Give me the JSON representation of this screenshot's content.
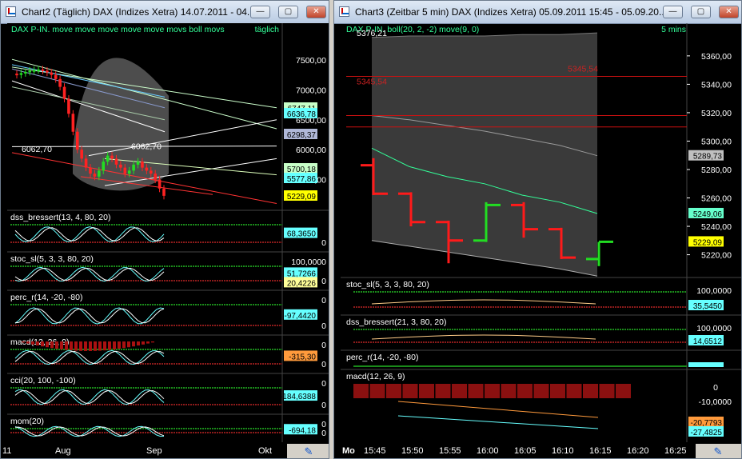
{
  "win1": {
    "title": "Chart2 (Täglich)  DAX (Indizes Xetra) 14.07.2011 - 04....",
    "buttons": [
      "—",
      "▢",
      "✕"
    ],
    "header": {
      "left": "DAX P-IN. move move move move move movs boll movs",
      "right": "täglich"
    },
    "main_ticks": [
      "7500,00",
      "7000,00",
      "6500,00",
      "6000,00",
      "5500,00"
    ],
    "annotations": [
      "6062,70",
      "6062,70"
    ],
    "value_boxes": [
      {
        "label": "6747,11",
        "color": "#c8ffc8"
      },
      {
        "label": "6636,78",
        "color": "#66ffff"
      },
      {
        "label": "6298,37",
        "color": "#b0b8d8"
      },
      {
        "label": "5700,18",
        "color": "#c8ffc8"
      },
      {
        "label": "5577,86",
        "color": "#66ffff"
      },
      {
        "label": "5229,09",
        "color": "#ffff00"
      }
    ],
    "panels": [
      {
        "name": "dss_bressert(13, 4, 80, 20)",
        "box": "68,3650",
        "box_color": "#66ffff",
        "zero": "0",
        "top": ""
      },
      {
        "name": "stoc_sl(5, 3, 3, 80, 20)",
        "box": "51,7266",
        "box2": "20,4226",
        "box_color": "#66ffff",
        "box2_color": "#ffff99",
        "zero": "0",
        "top": "100,0000"
      },
      {
        "name": "perc_r(14, -20, -80)",
        "box": "-97,4420",
        "box_color": "#66ffff",
        "zero": "0",
        "top": "0"
      },
      {
        "name": "macd(12, 26, 9)",
        "box": "-315,30",
        "box_color": "#ff9a3c",
        "zero": "0",
        "top": "0"
      },
      {
        "name": "cci(20, 100, -100)",
        "box": "-184,6388",
        "box_color": "#66ffff",
        "zero": "0",
        "top": "0"
      },
      {
        "name": "mom(20)",
        "box": "-694,18",
        "box_color": "#66ffff",
        "zero": "0",
        "top": "0"
      }
    ],
    "xaxis": [
      "11",
      "Aug",
      "Sep",
      "Okt"
    ]
  },
  "win2": {
    "title": "Chart3 (Zeitbar 5 min)  DAX (Indizes Xetra) 05.09.2011 15:45 - 05.09.20...",
    "buttons": [
      "—",
      "▢",
      "✕"
    ],
    "header": {
      "left": "DAX P-IN. boll(20, 2, -2) move(9, 0)",
      "right": "5 mins"
    },
    "main_ticks": [
      "5360,00",
      "5340,00",
      "5320,00",
      "5300,00",
      "5280,00",
      "5260,00",
      "5240,00",
      "5220,00"
    ],
    "annotations": [
      "5376,21",
      "5345,54",
      "5345,54"
    ],
    "value_boxes": [
      {
        "label": "5289,73",
        "color": "#c0c0c0"
      },
      {
        "label": "5249,06",
        "color": "#66ffcc"
      },
      {
        "label": "5229,09",
        "color": "#ffff00"
      }
    ],
    "panels": [
      {
        "name": "stoc_sl(5, 3, 3, 80, 20)",
        "top": "100,0000",
        "box": "35,5450",
        "box_color": "#66ffff"
      },
      {
        "name": "dss_bressert(21, 3, 80, 20)",
        "top": "100,0000",
        "box": "14,6512",
        "box_color": "#66ffff"
      },
      {
        "name": "perc_r(14, -20, -80)"
      },
      {
        "name": "macd(12, 26, 9)",
        "top": "0",
        "mid": "-10,0000",
        "box": "-20,7793",
        "box2": "-27,4825",
        "box_color": "#ff9a3c",
        "box2_color": "#66ffff"
      }
    ],
    "xaxis": [
      "Mo",
      "15:45",
      "15:50",
      "15:55",
      "16:00",
      "16:05",
      "16:10",
      "16:15",
      "16:20",
      "16:25"
    ]
  },
  "chart_data": [
    {
      "type": "bar",
      "title": "DAX P-IN. move move move move move movs boll movs",
      "timeframe": "täglich",
      "y_ticks": [
        5500,
        6000,
        6500,
        7000,
        7500
      ],
      "ylim": [
        5000,
        7900
      ],
      "last_values": [
        6747.11,
        6636.78,
        6298.37,
        5700.18,
        5577.86,
        5229.09
      ],
      "close_series": [
        7250,
        7280,
        7300,
        7320,
        7330,
        7340,
        7320,
        7290,
        7250,
        7180,
        7050,
        6850,
        6600,
        6300,
        6000,
        5850,
        5700,
        5600,
        5550,
        5650,
        5800,
        5900,
        5850,
        5750,
        5700,
        5600,
        5650,
        5750,
        5800,
        5700,
        5650,
        5600,
        5500,
        5350,
        5229.09
      ],
      "xaxis": [
        "11",
        "Aug",
        "Sep",
        "Okt"
      ]
    },
    {
      "type": "bar",
      "title": "DAX P-IN. boll(20, 2, -2) move(9, 0)",
      "timeframe": "5 mins",
      "y_ticks": [
        5220,
        5240,
        5260,
        5280,
        5300,
        5320,
        5340,
        5360
      ],
      "ylim": [
        5204,
        5374
      ],
      "bars": [
        {
          "t": "15:45",
          "o": 5283,
          "h": 5288,
          "l": 5262,
          "c": 5263,
          "color": "red"
        },
        {
          "t": "15:50",
          "o": 5263,
          "h": 5264,
          "l": 5240,
          "c": 5243,
          "color": "red"
        },
        {
          "t": "15:55",
          "o": 5243,
          "h": 5244,
          "l": 5214,
          "c": 5230,
          "color": "red"
        },
        {
          "t": "16:00",
          "o": 5230,
          "h": 5257,
          "l": 5229,
          "c": 5255,
          "color": "green"
        },
        {
          "t": "16:05",
          "o": 5255,
          "h": 5257,
          "l": 5232,
          "c": 5238,
          "color": "red"
        },
        {
          "t": "16:10",
          "o": 5238,
          "h": 5239,
          "l": 5217,
          "c": 5218,
          "color": "red"
        },
        {
          "t": "16:15",
          "o": 5217,
          "h": 5229,
          "l": 5212,
          "c": 5229.09,
          "color": "green"
        }
      ],
      "upper_band": [
        5373,
        5374,
        5374,
        5374,
        5375,
        5375,
        5376.21
      ],
      "lower_band": [
        5230,
        5226,
        5222,
        5218,
        5214,
        5210,
        5205
      ],
      "mid_line": [
        5318,
        5315,
        5311,
        5307,
        5302,
        5297,
        5289.73
      ],
      "ma_line": [
        5295,
        5282,
        5275,
        5270,
        5262,
        5257,
        5249.06
      ],
      "h_lines": [
        5345.54,
        5318,
        5310
      ],
      "macd_histogram": [
        -2,
        -2,
        -2,
        -4,
        -4,
        -4,
        -3,
        -3,
        -3,
        -2,
        -2,
        -2,
        -2,
        -2,
        -2,
        -2,
        -2
      ],
      "macd_signal": [
        -10.5,
        -20.7793
      ],
      "macd_line": [
        -16,
        -27.4825
      ]
    }
  ]
}
